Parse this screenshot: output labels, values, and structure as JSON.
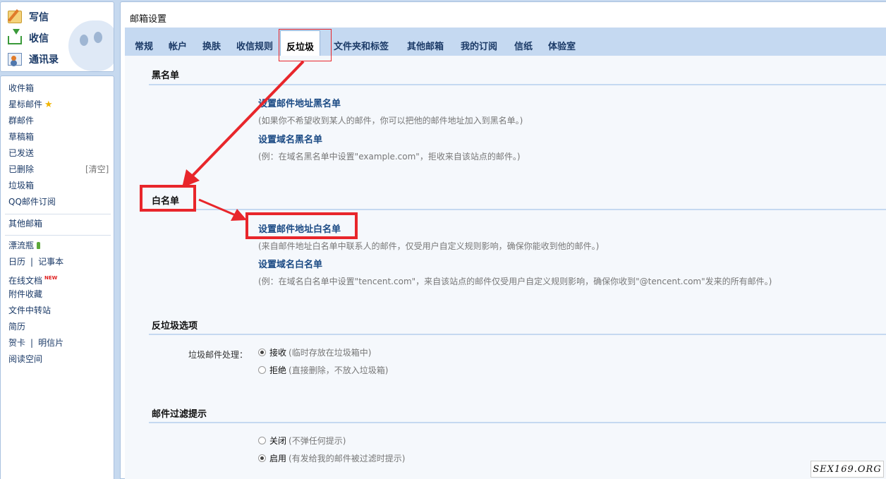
{
  "sidebar": {
    "actions": [
      {
        "label": "写信",
        "icon": "compose-icon"
      },
      {
        "label": "收信",
        "icon": "inbox-icon"
      },
      {
        "label": "通讯录",
        "icon": "contacts-icon"
      }
    ],
    "folders": {
      "inbox": "收件箱",
      "starred": "星标邮件",
      "group": "群邮件",
      "drafts": "草稿箱",
      "sent": "已发送",
      "deleted": "已删除",
      "deleted_clear": "[清空]",
      "spam": "垃圾箱",
      "subscriptions": "QQ邮件订阅",
      "other_mailboxes": "其他邮箱",
      "drift_bottle": "漂流瓶",
      "calendar": "日历",
      "notes": "记事本",
      "online_docs": "在线文档",
      "new_badge": "NEW",
      "attachments": "附件收藏",
      "file_transfer": "文件中转站",
      "resume": "简历",
      "greeting_card": "贺卡",
      "postcard": "明信片",
      "reading_space": "阅读空间",
      "separator": "|"
    }
  },
  "main": {
    "title": "邮箱设置",
    "tabs": [
      "常规",
      "帐户",
      "换肤",
      "收信规则",
      "反垃圾",
      "文件夹和标签",
      "其他邮箱",
      "我的订阅",
      "信纸",
      "体验室"
    ],
    "active_tab": "反垃圾",
    "blacklist": {
      "title": "黑名单",
      "address_link": "设置邮件地址黑名单",
      "address_desc": "(如果你不希望收到某人的邮件，你可以把他的邮件地址加入到黑名单。)",
      "domain_link": "设置域名黑名单",
      "domain_desc": "(例：在域名黑名单中设置\"example.com\"，拒收来自该站点的邮件。)"
    },
    "whitelist": {
      "title": "白名单",
      "address_link": "设置邮件地址白名单",
      "address_desc": "(来自邮件地址白名单中联系人的邮件，仅受用户自定义规则影响，确保你能收到他的邮件。)",
      "domain_link": "设置域名白名单",
      "domain_desc": "(例：在域名白名单中设置\"tencent.com\"，来自该站点的邮件仅受用户自定义规则影响，确保你收到\"@tencent.com\"发来的所有邮件。)"
    },
    "antispam": {
      "title": "反垃圾选项",
      "field_label": "垃圾邮件处理：",
      "accept_label": "接收",
      "accept_hint": "(临时存放在垃圾箱中)",
      "reject_label": "拒绝",
      "reject_hint": "(直接删除，不放入垃圾箱)",
      "selected": "接收"
    },
    "filter_notice": {
      "title": "邮件过滤提示",
      "off_label": "关闭",
      "off_hint": "(不弹任何提示)",
      "on_label": "启用",
      "on_hint": "(有发给我的邮件被过滤时提示)",
      "selected": "启用"
    }
  },
  "watermark": "SEX169.ORG",
  "colors": {
    "highlight": "#e8262b",
    "tabbar": "#c5d9f1",
    "link": "#1b4a84"
  }
}
